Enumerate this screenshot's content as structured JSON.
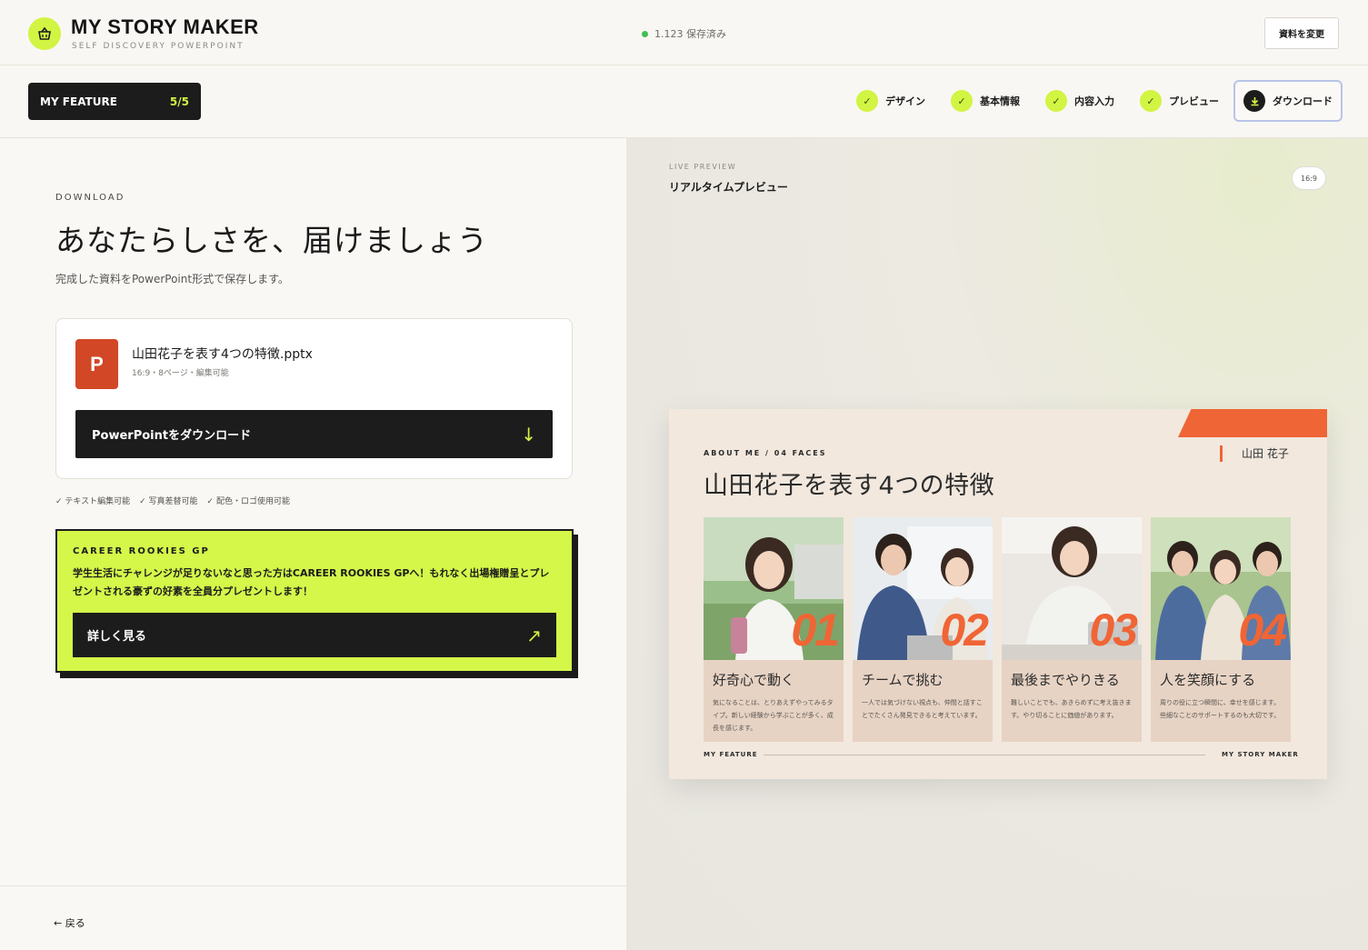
{
  "header": {
    "app_title": "MY STORY MAKER",
    "app_subtitle": "SELF DISCOVERY POWERPOINT",
    "logo_icon": "basket-icon",
    "save_status": "1.123 保存済み",
    "change_button": "資料を変更"
  },
  "stepbar": {
    "feature_label": "MY FEATURE",
    "feature_count": "5/5",
    "steps": [
      {
        "label": "デザイン",
        "icon": "check-icon",
        "state": "done"
      },
      {
        "label": "基本情報",
        "icon": "check-icon",
        "state": "done"
      },
      {
        "label": "内容入力",
        "icon": "check-icon",
        "state": "done"
      },
      {
        "label": "プレビュー",
        "icon": "check-icon",
        "state": "done"
      },
      {
        "label": "ダウンロード",
        "icon": "download-icon",
        "state": "active"
      }
    ]
  },
  "download": {
    "eyebrow": "DOWNLOAD",
    "title": "あなたらしさを、届けましょう",
    "description": "完成した資料をPowerPoint形式で保存します。",
    "file_icon_letter": "P",
    "file_name": "山田花子を表す4つの特徴.pptx",
    "file_meta": "16:9・8ページ・編集可能",
    "button_label": "PowerPointをダウンロード",
    "button_icon": "↓",
    "features": [
      "✓ テキスト編集可能",
      "✓ 写真差替可能",
      "✓ 配色・ロゴ使用可能"
    ]
  },
  "promo": {
    "eyebrow": "CAREER ROOKIES GP",
    "text": "学生生活にチャレンジが足りないなと思った方はCAREER ROOKIES GPへ！もれなく出場権贈呈とプレゼントされる豪ずの好素を全員分プレゼントします！",
    "button_label": "詳しく見る",
    "button_icon": "↗"
  },
  "footer": {
    "back_label": "← 戻る"
  },
  "preview": {
    "eyebrow": "LIVE PREVIEW",
    "title": "リアルタイムプレビュー",
    "ratio": "16:9"
  },
  "slide": {
    "eyebrow": "ABOUT ME / 04 FACES",
    "title": "山田花子を表す4つの特徴",
    "name": "山田 花子",
    "footer_left": "MY FEATURE",
    "footer_right": "MY STORY MAKER",
    "accent_color": "#f06535",
    "cards": [
      {
        "num": "01",
        "head": "好奇心で動く",
        "desc": "気になることは、とりあえずやってみるタイプ。新しい経験から学ぶことが多く、成長を感じます。"
      },
      {
        "num": "02",
        "head": "チームで挑む",
        "desc": "一人では気づけない視点も、仲間と話すことでたくさん発見できると考えています。"
      },
      {
        "num": "03",
        "head": "最後までやりきる",
        "desc": "難しいことでも、あきらめずに考え抜きます。やり切ることに価値があります。"
      },
      {
        "num": "04",
        "head": "人を笑顔にする",
        "desc": "周りの役に立つ瞬間に、幸せを感じます。些細なことのサポートするのも大切です。"
      }
    ]
  },
  "colors": {
    "accent_lime": "#d2f442",
    "accent_orange": "#f06535",
    "dark": "#1c1c1c",
    "save_green": "#3fbf54"
  }
}
